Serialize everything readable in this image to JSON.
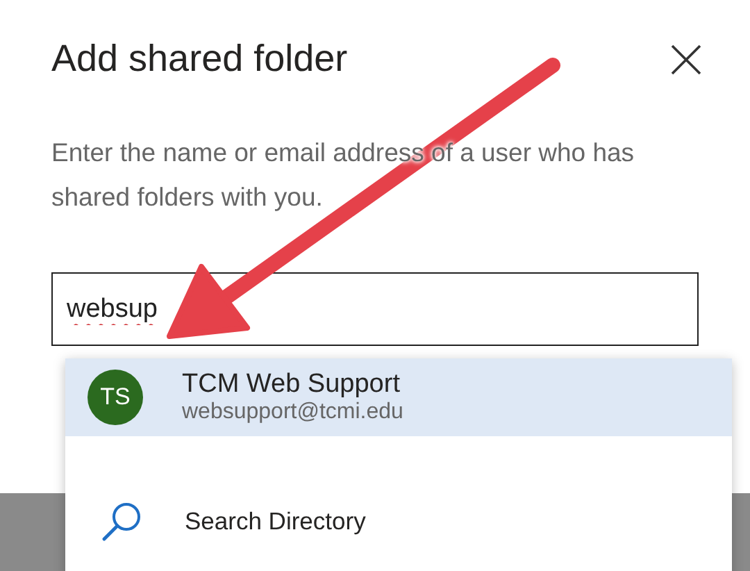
{
  "dialog": {
    "title": "Add shared folder",
    "description": "Enter the name or email address of a user who has shared folders with you."
  },
  "search_field": {
    "value": "websup",
    "misspelled": true
  },
  "suggestions": [
    {
      "kind": "contact",
      "initials": "TS",
      "name": "TCM Web Support",
      "email": "websupport@tcmi.edu",
      "selected": true
    },
    {
      "kind": "search",
      "label": "Search Directory",
      "selected": false
    }
  ],
  "annotation": {
    "kind": "arrow"
  }
}
